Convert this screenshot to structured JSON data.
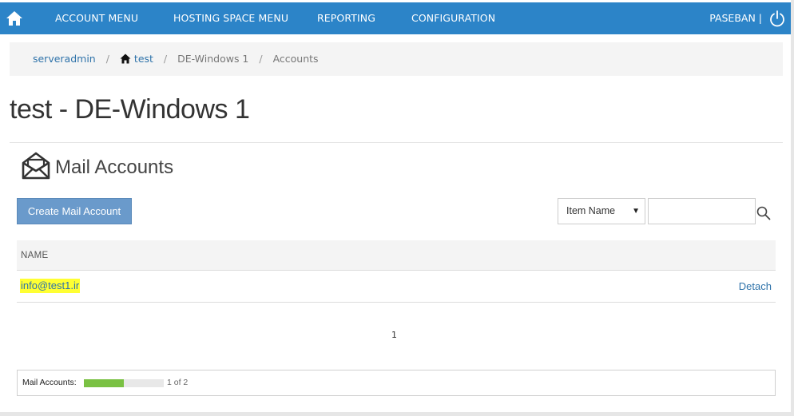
{
  "navbar": {
    "home_icon": "home-icon",
    "items": [
      {
        "label": "ACCOUNT MENU"
      },
      {
        "label": "HOSTING SPACE MENU"
      },
      {
        "label": "REPORTING"
      },
      {
        "label": "CONFIGURATION"
      }
    ],
    "user": "PASEBAN |",
    "power_icon": "power-icon",
    "color": "#2c84c8"
  },
  "breadcrumb": {
    "items": [
      "serveradmin",
      "test",
      "DE-Windows 1",
      "Accounts"
    ],
    "separator": "/"
  },
  "page": {
    "title": "test - DE-Windows 1"
  },
  "section": {
    "icon": "mail-envelope-icon",
    "title": "Mail Accounts"
  },
  "toolbar": {
    "create_label": "Create Mail Account",
    "filter_selected": "Item Name",
    "search_value": "",
    "search_placeholder": ""
  },
  "table": {
    "columns": [
      "NAME"
    ],
    "rows": [
      {
        "name": "info@test1.ir",
        "action": "Detach"
      }
    ]
  },
  "pager": {
    "current": "1"
  },
  "quota": {
    "label": "Mail Accounts:",
    "text": "1 of 2",
    "used": 1,
    "total": 2,
    "bar_color": "#7ac143"
  }
}
